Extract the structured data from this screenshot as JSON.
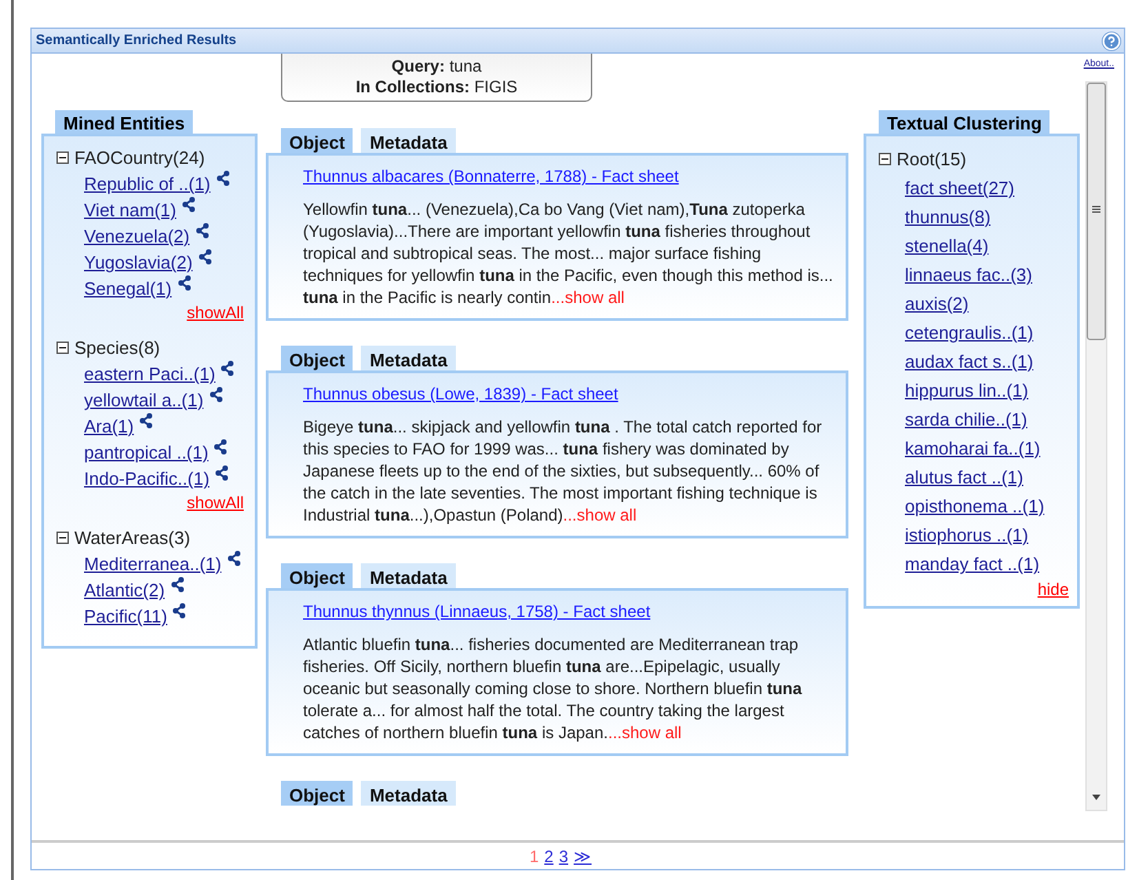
{
  "panel": {
    "title": "Semantically Enriched Results",
    "about": "About.."
  },
  "query": {
    "query_label": "Query:",
    "query_value": "tuna",
    "collections_label": "In Collections:",
    "collections_value": "FIGIS"
  },
  "mined_entities": {
    "title": "Mined Entities",
    "groups": [
      {
        "label": "FAOCountry(24)",
        "expanded": true,
        "items": [
          "Republic of ..(1)",
          "Viet nam(1)",
          "Venezuela(2)",
          "Yugoslavia(2)",
          "Senegal(1)"
        ],
        "more": "showAll"
      },
      {
        "label": "Species(8)",
        "expanded": true,
        "items": [
          "eastern Paci..(1)",
          "yellowtail a..(1)",
          "Ara(1)",
          "pantropical ..(1)",
          "Indo-Pacific..(1)"
        ],
        "more": "showAll"
      },
      {
        "label": "WaterAreas(3)",
        "expanded": true,
        "items": [
          "Mediterranea..(1)",
          "Atlantic(2)",
          "Pacific(11)"
        ]
      }
    ]
  },
  "results": [
    {
      "tabs": [
        {
          "label": "Object",
          "selected": true
        },
        {
          "label": "Metadata",
          "selected": false
        }
      ],
      "title": "Thunnus albacares (Bonnaterre, 1788) - Fact sheet",
      "snippet": "Yellowfin **tuna**... (Venezuela),Ca bo Vang (Viet nam),**Tuna** zutoperka (Yugoslavia)...There are important yellowfin **tuna** fisheries throughout tropical and subtropical seas. The most... major surface fishing techniques for yellowfin **tuna** in the Pacific, even though this method is... **tuna** in the Pacific is nearly contin",
      "more": "...show all"
    },
    {
      "tabs": [
        {
          "label": "Object",
          "selected": true
        },
        {
          "label": "Metadata",
          "selected": false
        }
      ],
      "title": "Thunnus obesus (Lowe, 1839) - Fact sheet",
      "snippet": "Bigeye **tuna**... skipjack and yellowfin **tuna** . The total catch reported for this species to FAO for 1999 was... **tuna** fishery was dominated by Japanese fleets up to the end of the sixties, but subsequently... 60% of the catch in the late seventies. The most important fishing technique is Industrial **tuna**...),Opastun (Poland)",
      "more": "...show all"
    },
    {
      "tabs": [
        {
          "label": "Object",
          "selected": true
        },
        {
          "label": "Metadata",
          "selected": false
        }
      ],
      "title": "Thunnus thynnus (Linnaeus, 1758) - Fact sheet",
      "snippet": "Atlantic bluefin **tuna**... fisheries documented are Mediterranean trap fisheries. Off Sicily, northern bluefin **tuna** are...Epipelagic, usually oceanic but seasonally coming close to shore. Northern bluefin **tuna** tolerate a... for almost half the total. The country taking the largest catches of northern bluefin **tuna** is Japan.",
      "more": "...show all"
    },
    {
      "tabs": [
        {
          "label": "Object",
          "selected": true
        },
        {
          "label": "Metadata",
          "selected": false
        }
      ]
    }
  ],
  "textual_clustering": {
    "title": "Textual Clustering",
    "root": {
      "label": "Root(15)",
      "expanded": true,
      "children": [
        "fact sheet(27)",
        "thunnus(8)",
        "stenella(4)",
        "linnaeus fac..(3)",
        "auxis(2)",
        "cetengraulis..(1)",
        "audax fact s..(1)",
        "hippurus lin..(1)",
        "sarda chilie..(1)",
        "kamoharai fa..(1)",
        "alutus fact ..(1)",
        "opisthonema ..(1)",
        "istiophorus ..(1)",
        "manday fact ..(1)"
      ]
    },
    "hide": "hide"
  },
  "pagination": [
    {
      "label": "1",
      "selected": true
    },
    {
      "label": "2",
      "selected": false
    },
    {
      "label": "3",
      "selected": false
    },
    {
      "label": "≫",
      "selected": false
    }
  ]
}
